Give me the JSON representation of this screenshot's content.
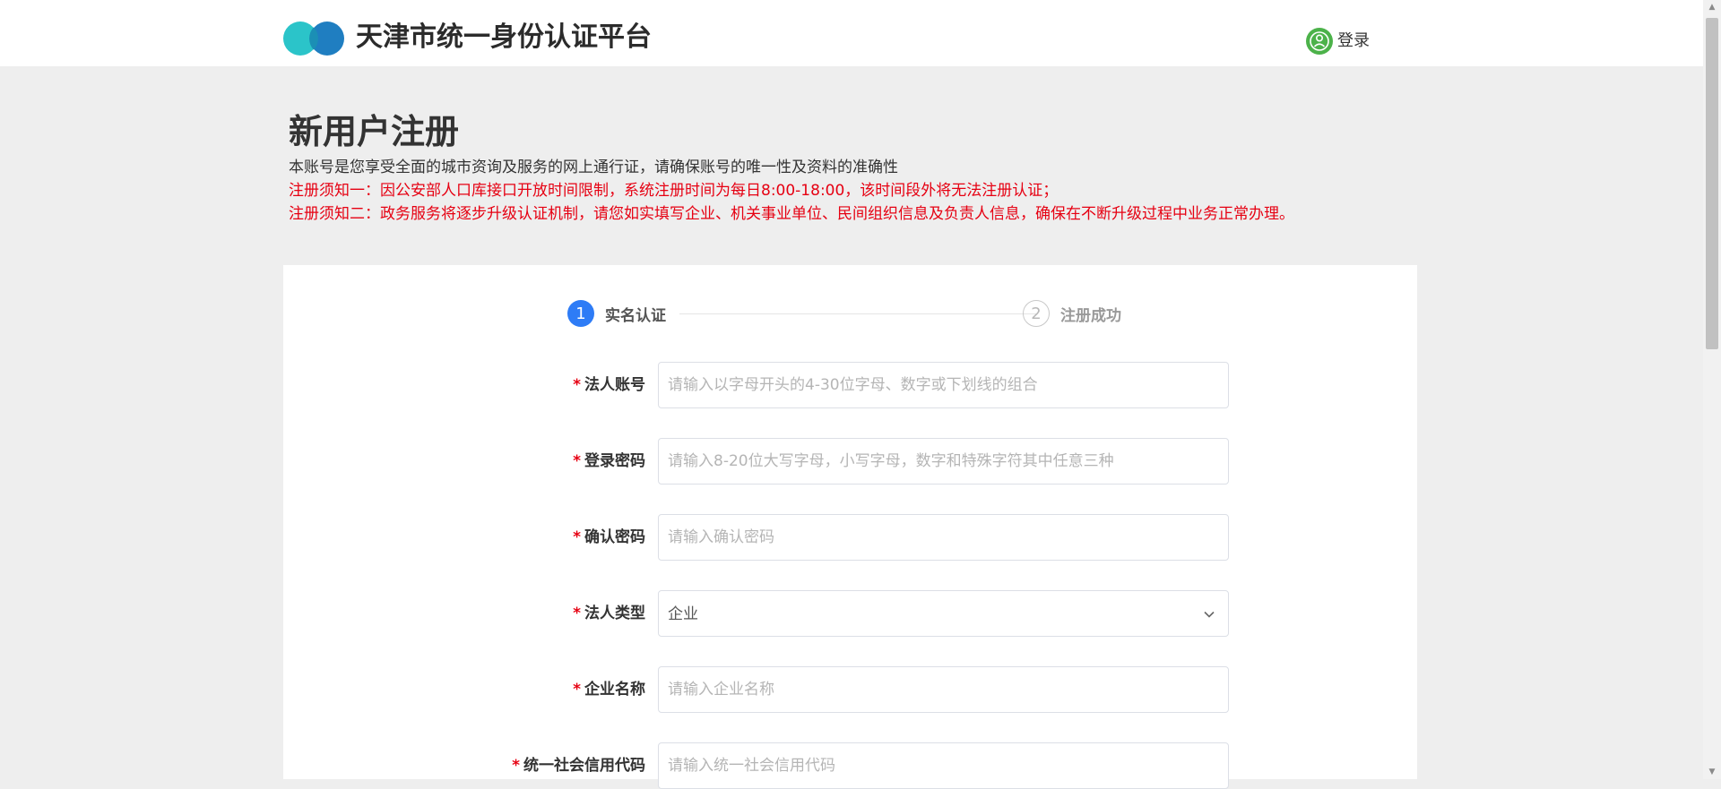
{
  "header": {
    "site_title": "天津市统一身份认证平台",
    "login_label": "登录"
  },
  "colors": {
    "accent_blue": "#2e7cf6",
    "warning_red": "#e60012",
    "logo_teal": "#2bc4c9",
    "logo_blue": "#1f7ec1",
    "login_icon_green": "#4cb24a"
  },
  "page": {
    "title": "新用户注册",
    "notes": [
      "本账号是您享受全面的城市资询及服务的网上通行证，请确保账号的唯一性及资料的准确性",
      "注册须知一：因公安部人口库接口开放时间限制，系统注册时间为每日8:00-18:00，该时间段外将无法注册认证；",
      "注册须知二：政务服务将逐步升级认证机制，请您如实填写企业、机关事业单位、民间组织信息及负责人信息，确保在不断升级过程中业务正常办理。"
    ]
  },
  "steps": [
    {
      "number": "1",
      "label": "实名认证",
      "active": true
    },
    {
      "number": "2",
      "label": "注册成功",
      "active": false
    }
  ],
  "form": {
    "required_mark": "*",
    "fields": [
      {
        "label": "法人账号",
        "placeholder": "请输入以字母开头的4-30位字母、数字或下划线的组合",
        "value": ""
      },
      {
        "label": "登录密码",
        "placeholder": "请输入8-20位大写字母，小写字母，数字和特殊字符其中任意三种",
        "value": ""
      },
      {
        "label": "确认密码",
        "placeholder": "请输入确认密码",
        "value": ""
      },
      {
        "label": "法人类型",
        "type": "select",
        "value": "企业"
      },
      {
        "label": "企业名称",
        "placeholder": "请输入企业名称",
        "value": ""
      },
      {
        "label": "统一社会信用代码",
        "placeholder": "请输入统一社会信用代码",
        "value": ""
      }
    ]
  }
}
